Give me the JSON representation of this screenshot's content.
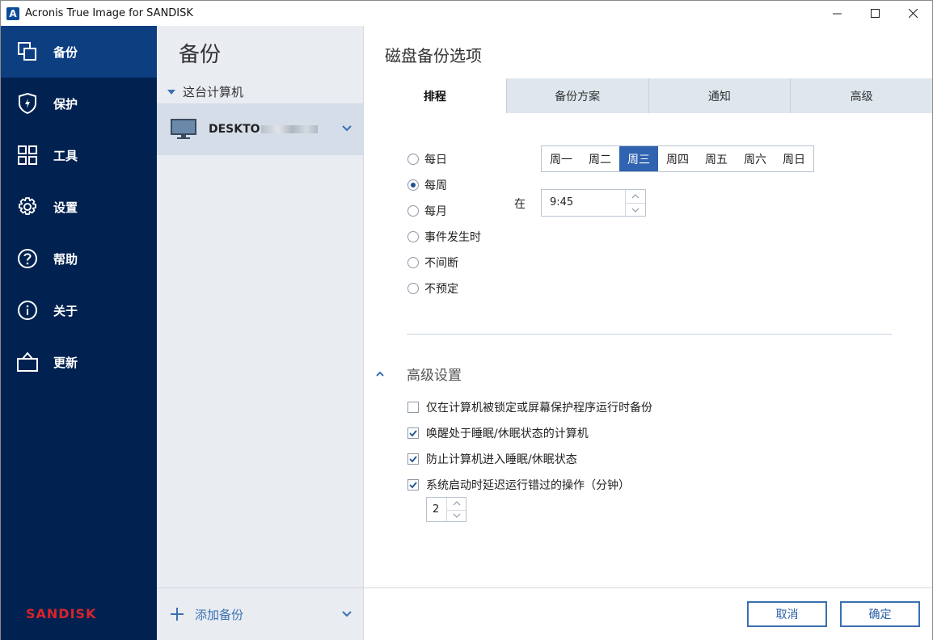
{
  "window": {
    "title": "Acronis True Image for SANDISK",
    "logo_letter": "A"
  },
  "nav": {
    "items": [
      {
        "label": "备份",
        "icon": "backup-icon",
        "active": true
      },
      {
        "label": "保护",
        "icon": "shield-icon"
      },
      {
        "label": "工具",
        "icon": "tools-grid-icon"
      },
      {
        "label": "设置",
        "icon": "gear-icon"
      },
      {
        "label": "帮助",
        "icon": "help-icon"
      },
      {
        "label": "关于",
        "icon": "info-icon"
      },
      {
        "label": "更新",
        "icon": "update-bag-icon"
      }
    ],
    "brand": "SANDISK"
  },
  "middle": {
    "title": "备份",
    "group_label": "这台计算机",
    "device_name": "DESKTO",
    "add_backup_label": "添加备份"
  },
  "main": {
    "title": "磁盘备份选项",
    "tabs": [
      {
        "label": "排程",
        "active": true
      },
      {
        "label": "备份方案"
      },
      {
        "label": "通知"
      },
      {
        "label": "高级"
      }
    ],
    "schedule_options": [
      {
        "label": "每日",
        "checked": false
      },
      {
        "label": "每周",
        "checked": true
      },
      {
        "label": "每月",
        "checked": false
      },
      {
        "label": "事件发生时",
        "checked": false
      },
      {
        "label": "不间断",
        "checked": false
      },
      {
        "label": "不预定",
        "checked": false
      }
    ],
    "weekdays": [
      {
        "label": "周一"
      },
      {
        "label": "周二"
      },
      {
        "label": "周三",
        "selected": true
      },
      {
        "label": "周四"
      },
      {
        "label": "周五"
      },
      {
        "label": "周六"
      },
      {
        "label": "周日"
      }
    ],
    "at_label": "在",
    "time_value": "9:45",
    "advanced_title": "高级设置",
    "advanced_options": [
      {
        "label": "仅在计算机被锁定或屏幕保护程序运行时备份",
        "checked": false
      },
      {
        "label": "唤醒处于睡眠/休眠状态的计算机",
        "checked": true
      },
      {
        "label": "防止计算机进入睡眠/休眠状态",
        "checked": true
      },
      {
        "label": "系统启动时延迟运行错过的操作（分钟）",
        "checked": true
      }
    ],
    "delay_minutes": "2",
    "cancel_label": "取消",
    "ok_label": "确定"
  },
  "colors": {
    "nav_bg": "#012250",
    "nav_active": "#0d3e80",
    "accent": "#3063b0",
    "brand_red": "#d8232a"
  }
}
